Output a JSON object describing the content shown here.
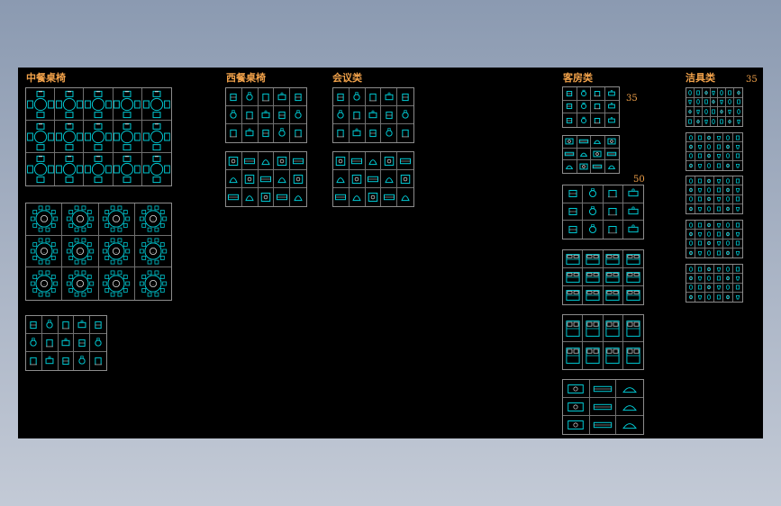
{
  "canvas": {
    "background": "#000000",
    "line_color": "#00c8d2",
    "frame_color": "#8c8c8c",
    "text_color": "#f2a24a"
  },
  "sections": {
    "chinese_dining": {
      "title": "中餐桌椅"
    },
    "western_dining": {
      "title": "西餐桌椅"
    },
    "meeting": {
      "title": "会议类"
    },
    "guest_room": {
      "title": "客房类",
      "labels": [
        "35",
        "50"
      ]
    },
    "bathroom": {
      "title": "洁具类",
      "labels": [
        "35"
      ]
    }
  },
  "grids": [
    {
      "id": "cd-1",
      "cols": 5,
      "rows": 3,
      "symbol": "table-cross"
    },
    {
      "id": "cd-2",
      "cols": 4,
      "rows": 3,
      "symbol": "round-table"
    },
    {
      "id": "cd-3",
      "cols": 5,
      "rows": 3,
      "symbol": "small"
    },
    {
      "id": "wd-1",
      "cols": 5,
      "rows": 3,
      "symbol": "small"
    },
    {
      "id": "wd-2",
      "cols": 5,
      "rows": 3,
      "symbol": "mixed-top"
    },
    {
      "id": "mt-1",
      "cols": 5,
      "rows": 3,
      "symbol": "small"
    },
    {
      "id": "mt-2",
      "cols": 5,
      "rows": 3,
      "symbol": "mixed-top"
    },
    {
      "id": "gr-1",
      "cols": 4,
      "rows": 3,
      "symbol": "small"
    },
    {
      "id": "gr-2",
      "cols": 4,
      "rows": 3,
      "symbol": "mixed-top"
    },
    {
      "id": "gr-3",
      "cols": 4,
      "rows": 3,
      "symbol": "small"
    },
    {
      "id": "gr-4",
      "cols": 4,
      "rows": 3,
      "symbol": "bed"
    },
    {
      "id": "gr-5",
      "cols": 4,
      "rows": 2,
      "symbol": "bed"
    },
    {
      "id": "gr-6",
      "cols": 3,
      "rows": 3,
      "symbol": "mixed-top"
    },
    {
      "id": "bt-1",
      "cols": 7,
      "rows": 4,
      "symbol": "tiny"
    },
    {
      "id": "bt-2",
      "cols": 6,
      "rows": 4,
      "symbol": "tiny"
    },
    {
      "id": "bt-3",
      "cols": 6,
      "rows": 4,
      "symbol": "tiny"
    },
    {
      "id": "bt-4",
      "cols": 6,
      "rows": 4,
      "symbol": "tiny"
    },
    {
      "id": "bt-5",
      "cols": 6,
      "rows": 4,
      "symbol": "tiny"
    }
  ]
}
